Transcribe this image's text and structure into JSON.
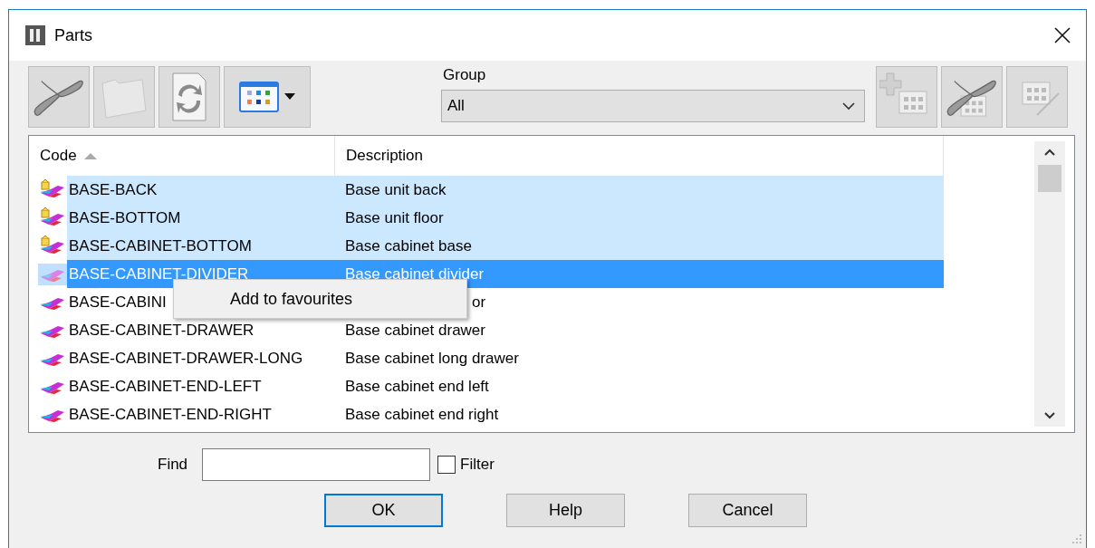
{
  "window": {
    "title": "Parts"
  },
  "group": {
    "label": "Group",
    "value": "All"
  },
  "table": {
    "columns": [
      {
        "label": "Code",
        "sorted": true
      },
      {
        "label": "Description",
        "sorted": false
      }
    ],
    "rows": [
      {
        "kind": "favourite",
        "code": "BASE-BACK",
        "description": "Base unit back",
        "selected": true,
        "current": false
      },
      {
        "kind": "favourite",
        "code": "BASE-BOTTOM",
        "description": "Base unit floor",
        "selected": true,
        "current": false
      },
      {
        "kind": "favourite",
        "code": "BASE-CABINET-BOTTOM",
        "description": "Base cabinet base",
        "selected": true,
        "current": false
      },
      {
        "kind": "part",
        "code": "BASE-CABINET-DIVIDER",
        "description": "Base cabinet divider",
        "selected": true,
        "current": true
      },
      {
        "kind": "part",
        "code": "BASE-CABINI",
        "description": "or",
        "selected": false,
        "current": false,
        "covered": true
      },
      {
        "kind": "part",
        "code": "BASE-CABINET-DRAWER",
        "description": "Base cabinet drawer",
        "selected": false,
        "current": false
      },
      {
        "kind": "part",
        "code": "BASE-CABINET-DRAWER-LONG",
        "description": "Base cabinet long drawer",
        "selected": false,
        "current": false
      },
      {
        "kind": "part",
        "code": "BASE-CABINET-END-LEFT",
        "description": "Base cabinet end left",
        "selected": false,
        "current": false
      },
      {
        "kind": "part",
        "code": "BASE-CABINET-END-RIGHT",
        "description": "Base cabinet end right",
        "selected": false,
        "current": false
      }
    ]
  },
  "context_menu": {
    "items": [
      "Add to favourites"
    ]
  },
  "find": {
    "label": "Find"
  },
  "filter": {
    "label": "Filter",
    "checked": false
  },
  "buttons": [
    {
      "label": "OK",
      "default": true
    },
    {
      "label": "Help",
      "default": false
    },
    {
      "label": "Cancel",
      "default": false
    }
  ]
}
